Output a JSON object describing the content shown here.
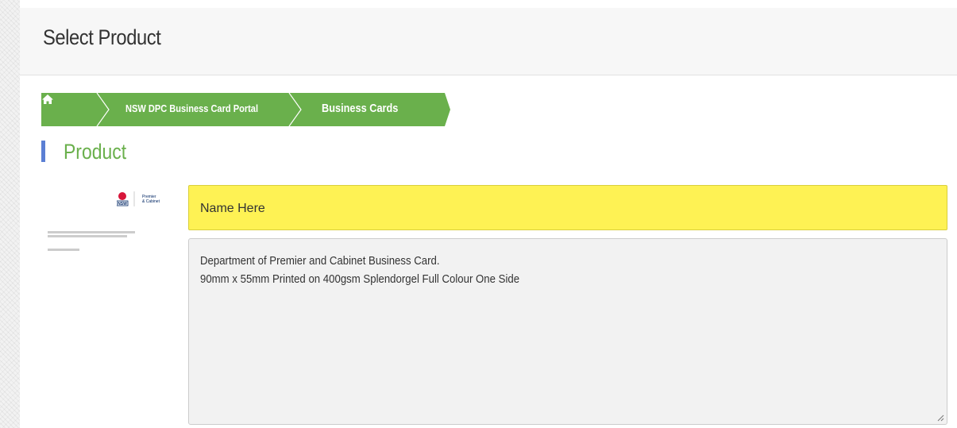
{
  "header": {
    "title": "Select Product"
  },
  "breadcrumb": {
    "items": [
      {
        "label": "NSW DPC Business Card Portal"
      },
      {
        "label": "Business Cards"
      }
    ],
    "home_icon": "home-icon",
    "color": "#6ab04c"
  },
  "section": {
    "title": "Product",
    "accent": "#5b7fd4"
  },
  "card": {
    "logo_text": "NSW",
    "logo_sub_1": "Premier",
    "logo_sub_2": "& Cabinet"
  },
  "form": {
    "name_value": "Name Here",
    "description_lines": [
      "Department of Premier and Cabinet Business Card.",
      "90mm x 55mm Printed on 400gsm Splendorgel Full Colour One Side"
    ]
  },
  "colors": {
    "name_field_bg": "#fef254",
    "desc_bg": "#f2f2f2",
    "title_green": "#6ab04c"
  }
}
